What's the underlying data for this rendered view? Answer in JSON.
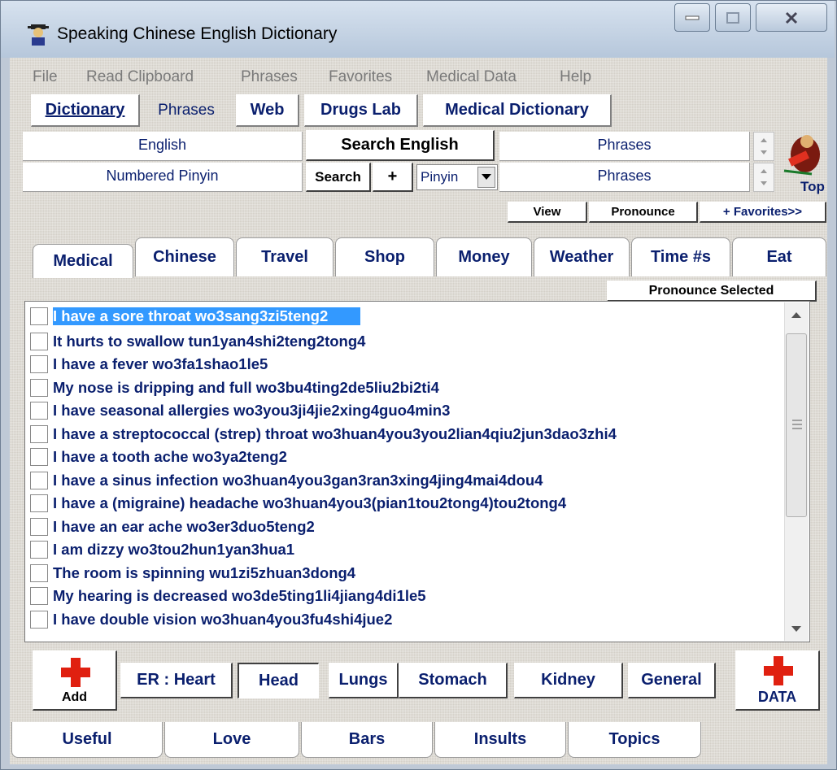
{
  "window": {
    "title": "Speaking Chinese English Dictionary"
  },
  "menu": [
    "File",
    "Read Clipboard",
    "Phrases",
    "Favorites",
    "Medical Data",
    "Help"
  ],
  "nav": {
    "dictionary": "Dictionary",
    "phrases": "Phrases",
    "web": "Web",
    "drugs_lab": "Drugs Lab",
    "medical_dictionary": "Medical Dictionary"
  },
  "search": {
    "field1": "English",
    "field2": "Numbered Pinyin",
    "search_english_label": "Search English",
    "search_label": "Search",
    "plus_label": "+",
    "pinyin_select": "Pinyin",
    "result1": "Phrases",
    "result2": "Phrases",
    "top_label": "Top"
  },
  "actions": {
    "view": "View",
    "pronounce": "Pronounce",
    "favorites": "+ Favorites>>"
  },
  "tabs": [
    "Medical",
    "Chinese",
    "Travel",
    "Shop",
    "Money",
    "Weather",
    "Time #s",
    "Eat"
  ],
  "pronounce_selected": "Pronounce Selected",
  "phrases": [
    "I have a sore throat wo3sang3zi5teng2",
    "It hurts to swallow tun1yan4shi2teng2tong4",
    "I have a fever wo3fa1shao1le5",
    "My nose is dripping and full wo3bu4ting2de5liu2bi2ti4",
    "I have seasonal allergies wo3you3ji4jie2xing4guo4min3",
    "I have a streptococcal (strep) throat wo3huan4you3you2lian4qiu2jun3dao3zhi4",
    "I have a tooth ache wo3ya2teng2",
    "I have a sinus infection wo3huan4you3gan3ran3xing4jing4mai4dou4",
    "I have a (migraine) headache wo3huan4you3(pian1tou2tong4)tou2tong4",
    "I have an ear ache wo3er3duo5teng2",
    "I am dizzy wo3tou2hun1yan3hua1",
    "The room is spinning wu1zi5zhuan3dong4",
    "My hearing is decreased wo3de5ting1li4jiang4di1le5",
    "I have double vision wo3huan4you3fu4shi4jue2"
  ],
  "add_label": "Add",
  "data_label": "DATA",
  "categories": [
    "ER : Heart",
    "Head",
    "Lungs",
    "Stomach",
    "Kidney",
    "General"
  ],
  "bottom_tabs": [
    "Useful",
    "Love",
    "Bars",
    "Insults",
    "Topics"
  ],
  "colors": {
    "accent_text": "#0a1f6e",
    "selection": "#3399ff",
    "red_cross": "#e02010"
  }
}
